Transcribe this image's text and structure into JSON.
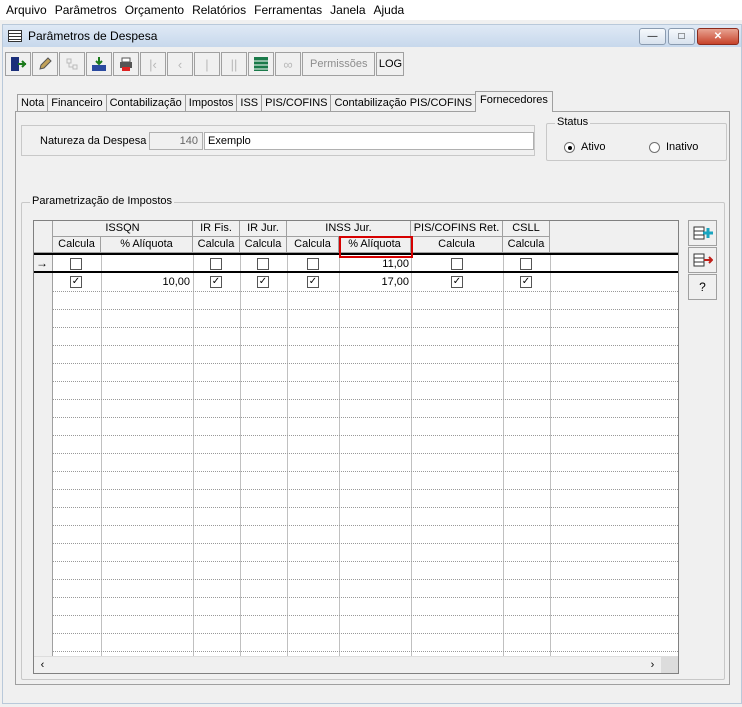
{
  "menu": [
    "Arquivo",
    "Parâmetros",
    "Orçamento",
    "Relatórios",
    "Ferramentas",
    "Janela",
    "Ajuda"
  ],
  "window": {
    "title": "Parâmetros de Despesa"
  },
  "toolbar": {
    "permissoes_label": "Permissões",
    "log_label": "LOG"
  },
  "tabs": [
    "Nota",
    "Financeiro",
    "Contabilização",
    "Impostos",
    "ISS",
    "PIS/COFINS",
    "Contabilização PIS/COFINS",
    "Fornecedores"
  ],
  "active_tab": "Fornecedores",
  "natureza": {
    "label": "Natureza da Despesa",
    "code": "140",
    "name": "Exemplo"
  },
  "status": {
    "legend": "Status",
    "options": [
      "Ativo",
      "Inativo"
    ],
    "selected": "Ativo"
  },
  "params": {
    "legend": "Parametrização de Impostos",
    "group_headers": [
      "ISSQN",
      "IR Fis.",
      "IR Jur.",
      "INSS Jur.",
      "PIS/COFINS Ret.",
      "CSLL"
    ],
    "sub_headers": [
      "Calcula",
      "% Alíquota",
      "Calcula",
      "Calcula",
      "Calcula",
      "% Alíquota",
      "Calcula",
      "Calcula"
    ],
    "rows": [
      {
        "current": true,
        "issqn_calc": false,
        "issqn_aliq": "",
        "irfis": false,
        "irjur": false,
        "inss_calc": false,
        "inss_aliq": "11,00",
        "pis": false,
        "csll": false
      },
      {
        "current": false,
        "issqn_calc": true,
        "issqn_aliq": "10,00",
        "irfis": true,
        "irjur": true,
        "inss_calc": true,
        "inss_aliq": "17,00",
        "pis": true,
        "csll": true
      }
    ]
  },
  "side_buttons": {
    "help_label": "?"
  }
}
